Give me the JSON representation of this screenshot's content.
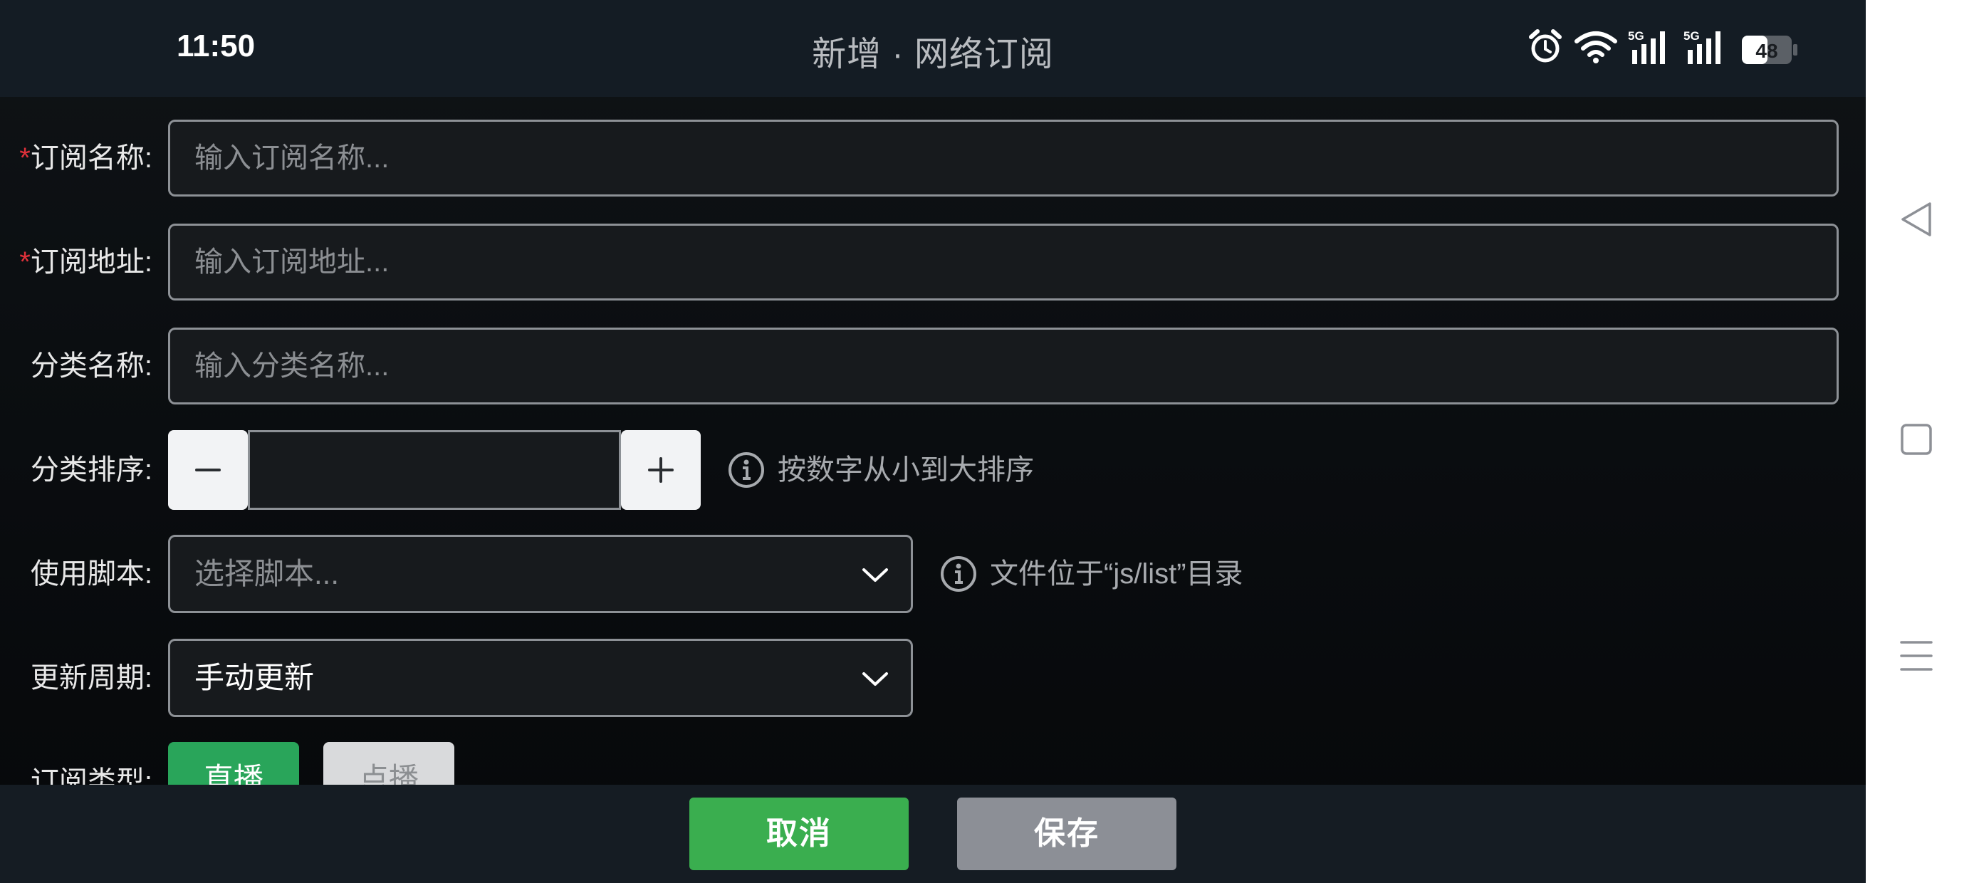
{
  "status_bar": {
    "time": "11:50",
    "battery": "48",
    "signal_1": "5G",
    "signal_2": "5G",
    "icons": [
      "alarm-icon",
      "wifi-icon",
      "signal-5g-icon",
      "signal-5g-icon",
      "battery-icon"
    ]
  },
  "header": {
    "title": "新增 · 网络订阅"
  },
  "form": {
    "name": {
      "required_mark": "*",
      "label": "订阅名称:",
      "placeholder": "输入订阅名称..."
    },
    "url": {
      "required_mark": "*",
      "label": "订阅地址:",
      "placeholder": "输入订阅地址..."
    },
    "category": {
      "label": "分类名称:",
      "placeholder": "输入分类名称..."
    },
    "sort": {
      "label": "分类排序:",
      "value": "",
      "decrement_icon": "minus-icon",
      "increment_icon": "plus-icon",
      "hint": "按数字从小到大排序"
    },
    "script": {
      "label": "使用脚本:",
      "placeholder": "选择脚本...",
      "hint": "文件位于“js/list”目录"
    },
    "update": {
      "label": "更新周期:",
      "selected": "手动更新"
    },
    "type": {
      "label": "订阅类型:",
      "options": [
        "直播",
        "点播"
      ],
      "selected": "直播"
    }
  },
  "actions": {
    "cancel": "取消",
    "save": "保存"
  },
  "colors": {
    "primary_green": "#3aae4f",
    "selected_segment": "#29a55a",
    "save_gray": "#8c8f96",
    "required_red": "#e0313a"
  }
}
